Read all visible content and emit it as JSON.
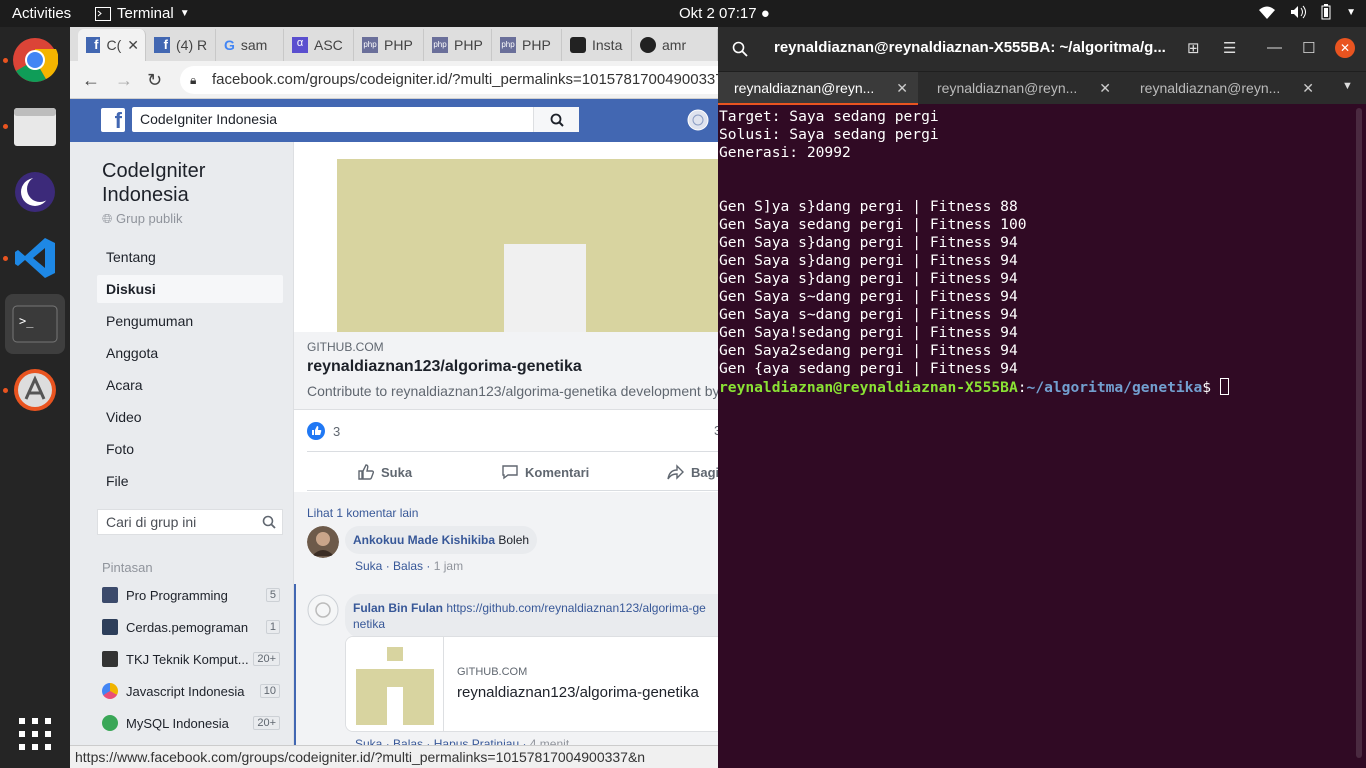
{
  "topbar": {
    "activities": "Activities",
    "app_name": "Terminal",
    "clock": "Okt 2  07:17"
  },
  "dock": {
    "items": [
      "chrome-icon",
      "files-icon",
      "eclipse-icon",
      "vscode-icon",
      "terminal-icon",
      "software-icon",
      "apps-grid-icon"
    ]
  },
  "browser": {
    "tabs": [
      "C(",
      "(4) R",
      "sam",
      "ASC",
      "PHP",
      "PHP",
      "PHP",
      "Insta",
      "amr"
    ],
    "url": "facebook.com/groups/codeigniter.id/?multi_permalinks=10157817004900337&n",
    "status_url": "https://www.facebook.com/groups/codeigniter.id/?multi_permalinks=10157817004900337&n"
  },
  "fb": {
    "search_value": "CodeIgniter Indonesia",
    "group_name": "CodeIgniter Indonesia",
    "group_type": "Grup publik",
    "nav": [
      "Tentang",
      "Diskusi",
      "Pengumuman",
      "Anggota",
      "Acara",
      "Video",
      "Foto",
      "File"
    ],
    "group_search_placeholder": "Cari di grup ini",
    "shortcuts_label": "Pintasan",
    "shortcuts": [
      {
        "label": "Pro Programming",
        "count": "5",
        "color": "#3b4a6b"
      },
      {
        "label": "Cerdas.pemograman",
        "count": "1",
        "color": "#2d3e5a"
      },
      {
        "label": "TKJ Teknik Komput...",
        "count": "20+",
        "color": "#333333"
      },
      {
        "label": "Javascript Indonesia",
        "count": "10",
        "color": "#f0b400"
      },
      {
        "label": "MySQL Indonesia",
        "count": "20+",
        "color": "#3aa757"
      }
    ],
    "card": {
      "source": "GITHUB.COM",
      "title": "reynaldiaznan123/algorima-genetika",
      "description": "Contribute to reynaldiaznan123/algorima-genetika development by"
    },
    "reaction_count": "3",
    "reaction_right": "3",
    "actions": [
      "Suka",
      "Komentari",
      "Bagi"
    ],
    "more_comments": "Lihat 1 komentar lain",
    "comment1": {
      "author": "Ankokuu Made Kishikiba",
      "text": "Boleh",
      "like": "Suka",
      "reply": "Balas",
      "time": "1 jam"
    },
    "comment2": {
      "author": "Fulan Bin Fulan",
      "text": "https://github.com/reynaldiaznan123/algorima-genetika",
      "like": "Suka",
      "reply": "Balas",
      "remove": "Hapus Pratinjau",
      "time": "4 menit"
    },
    "linkcard": {
      "source": "GITHUB.COM",
      "title": "reynaldiaznan123/algorima-genetika"
    }
  },
  "terminal": {
    "title": "reynaldiaznan@reynaldiaznan-X555BA: ~/algoritma/g...",
    "tabs": [
      "reynaldiaznan@reyn...",
      "reynaldiaznan@reyn...",
      "reynaldiaznan@reyn..."
    ],
    "lines": [
      "Target: Saya sedang pergi",
      "Solusi: Saya sedang pergi",
      "Generasi: 20992",
      "",
      "",
      "Gen S]ya s}dang pergi | Fitness 88",
      "Gen Saya sedang pergi | Fitness 100",
      "Gen Saya s}dang pergi | Fitness 94",
      "Gen Saya s}dang pergi | Fitness 94",
      "Gen Saya s}dang pergi | Fitness 94",
      "Gen Saya s~dang pergi | Fitness 94",
      "Gen Saya s~dang pergi | Fitness 94",
      "Gen Saya!sedang pergi | Fitness 94",
      "Gen Saya2sedang pergi | Fitness 94",
      "Gen {aya sedang pergi | Fitness 94"
    ],
    "prompt_user": "reynaldiaznan@reynaldiaznan-X555BA",
    "prompt_path": "~/algoritma/genetika",
    "prompt_suffix": "$ "
  }
}
